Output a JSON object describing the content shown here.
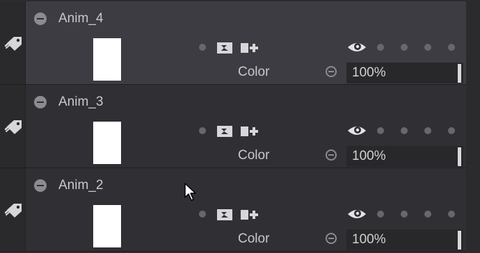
{
  "layers": [
    {
      "name": "Anim_4",
      "blend_mode": "Color",
      "opacity": "100%",
      "selected": true,
      "visible_icon": "eye-icon",
      "tag_icon": "tag-icon",
      "collapse_icon": "minus-circle-icon"
    },
    {
      "name": "Anim_3",
      "blend_mode": "Color",
      "opacity": "100%",
      "selected": false,
      "visible_icon": "eye-icon",
      "tag_icon": "tag-icon",
      "collapse_icon": "minus-circle-icon"
    },
    {
      "name": "Anim_2",
      "blend_mode": "Color",
      "opacity": "100%",
      "selected": false,
      "visible_icon": "eye-icon",
      "tag_icon": "tag-icon",
      "collapse_icon": "minus-circle-icon"
    }
  ],
  "colors": {
    "panel_bg": "#2c2c2f",
    "selected_bg": "#3c3c42",
    "text": "#c9c9cc",
    "thumbnail": "#ffffff"
  }
}
